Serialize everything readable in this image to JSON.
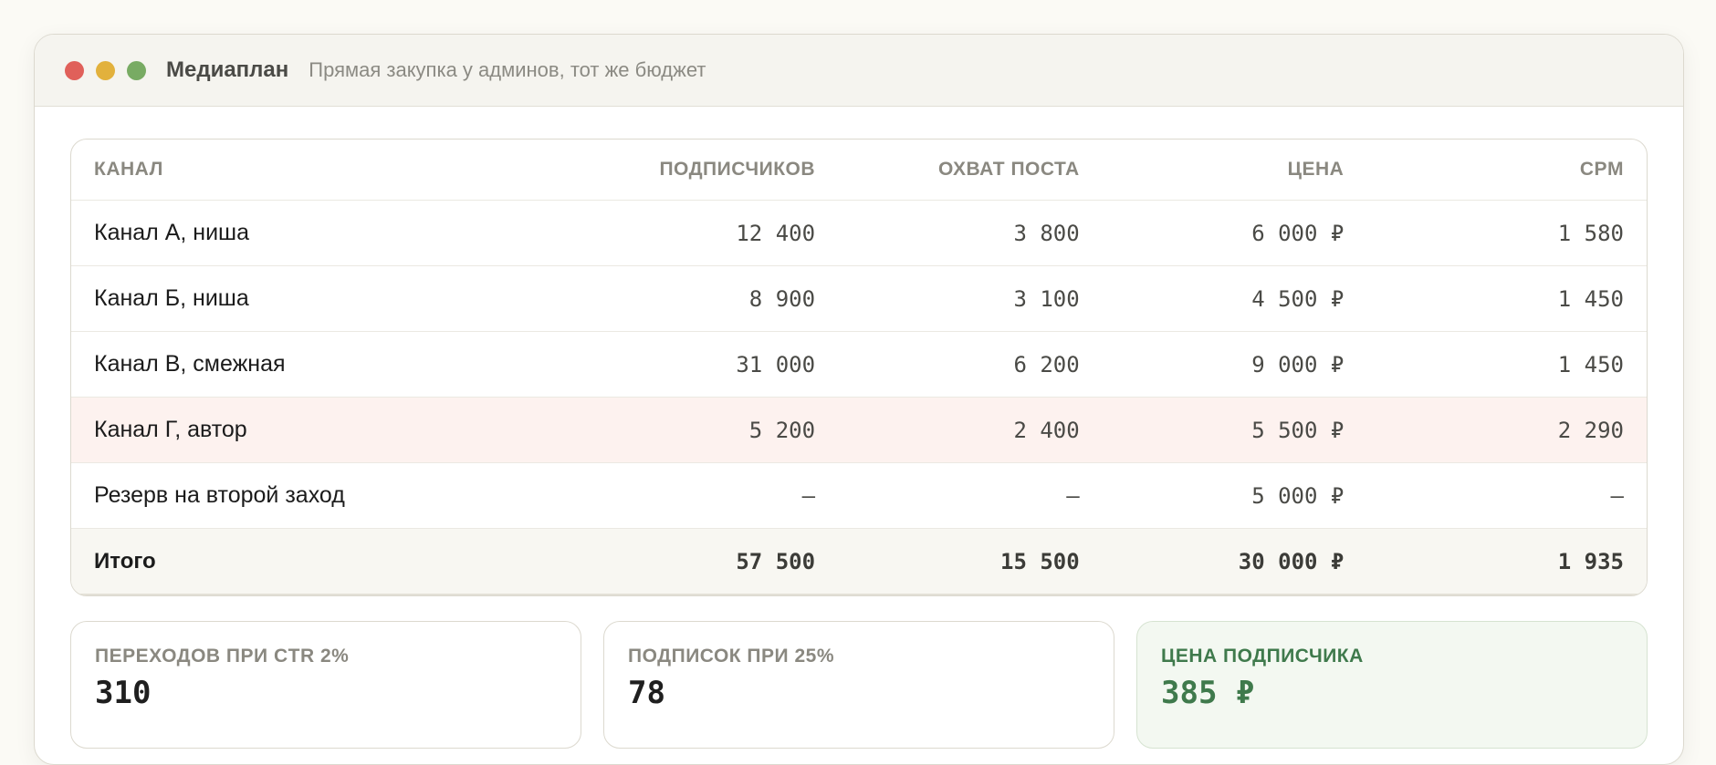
{
  "window": {
    "title": "Медиаплан",
    "subtitle": "Прямая закупка у админов, тот же бюджет"
  },
  "table": {
    "columns": [
      "КАНАЛ",
      "ПОДПИСЧИКОВ",
      "ОХВАТ ПОСТА",
      "ЦЕНА",
      "CPM"
    ],
    "rows": [
      {
        "channel": "Канал А, ниша",
        "subscribers": "12 400",
        "reach": "3 800",
        "price": "6 000 ₽",
        "cpm": "1 580"
      },
      {
        "channel": "Канал Б, ниша",
        "subscribers": "8 900",
        "reach": "3 100",
        "price": "4 500 ₽",
        "cpm": "1 450"
      },
      {
        "channel": "Канал В, смежная",
        "subscribers": "31 000",
        "reach": "6 200",
        "price": "9 000 ₽",
        "cpm": "1 450"
      },
      {
        "channel": "Канал Г, автор",
        "subscribers": "5 200",
        "reach": "2 400",
        "price": "5 500 ₽",
        "cpm": "2 290",
        "highlighted": true
      },
      {
        "channel": "Резерв на второй заход",
        "subscribers": "—",
        "reach": "—",
        "price": "5 000 ₽",
        "cpm": "—"
      }
    ],
    "total": {
      "channel": "Итого",
      "subscribers": "57 500",
      "reach": "15 500",
      "price": "30 000 ₽",
      "cpm": "1 935"
    }
  },
  "stats": [
    {
      "label": "ПЕРЕХОДОВ ПРИ CTR 2%",
      "value": "310"
    },
    {
      "label": "ПОДПИСОК ПРИ 25%",
      "value": "78"
    },
    {
      "label": "ЦЕНА ПОДПИСЧИКА",
      "value": "385 ₽",
      "accent": true
    }
  ],
  "colors": {
    "close": "#e0605a",
    "minimize": "#e2b13c",
    "maximize": "#78ab63",
    "highlight_row": "#fdf2ef",
    "accent_green": "#3f7a4c"
  }
}
